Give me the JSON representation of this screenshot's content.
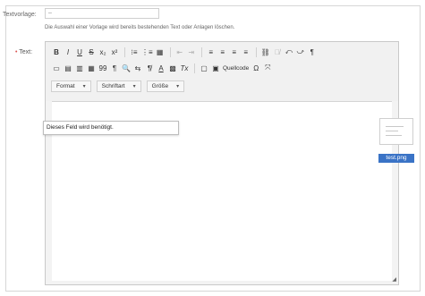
{
  "template": {
    "label": "Textvorlage:",
    "select_value": "–",
    "hint": "Die Auswahl einer Vorlage wird bereits bestehenden Text oder Anlagen löschen."
  },
  "text_field": {
    "required_marker": "•",
    "label": "Text:"
  },
  "toolbar": {
    "row1": [
      "B",
      "I",
      "U",
      "S",
      "x₂",
      "x²",
      "⁝≡",
      "⋮≡",
      "▦",
      "⇤",
      "⇥",
      "≡",
      "≡",
      "≡",
      "≡",
      "⛓",
      "⛓̸",
      "⤺",
      "⤻",
      "¶"
    ],
    "row2": [
      "▭",
      "▤",
      "▥",
      "▦",
      "99",
      "¶",
      "🔍",
      "⇆",
      "¶̸",
      "A",
      "▩",
      "Tx",
      "▢",
      "▣",
      "Quellcode",
      "Ω",
      "⤧"
    ],
    "format_label": "Format",
    "font_label": "Schriftart",
    "size_label": "Größe"
  },
  "validation_tooltip": "Dieses Feld wird benötigt.",
  "attachment": {
    "filename": "test.png"
  }
}
